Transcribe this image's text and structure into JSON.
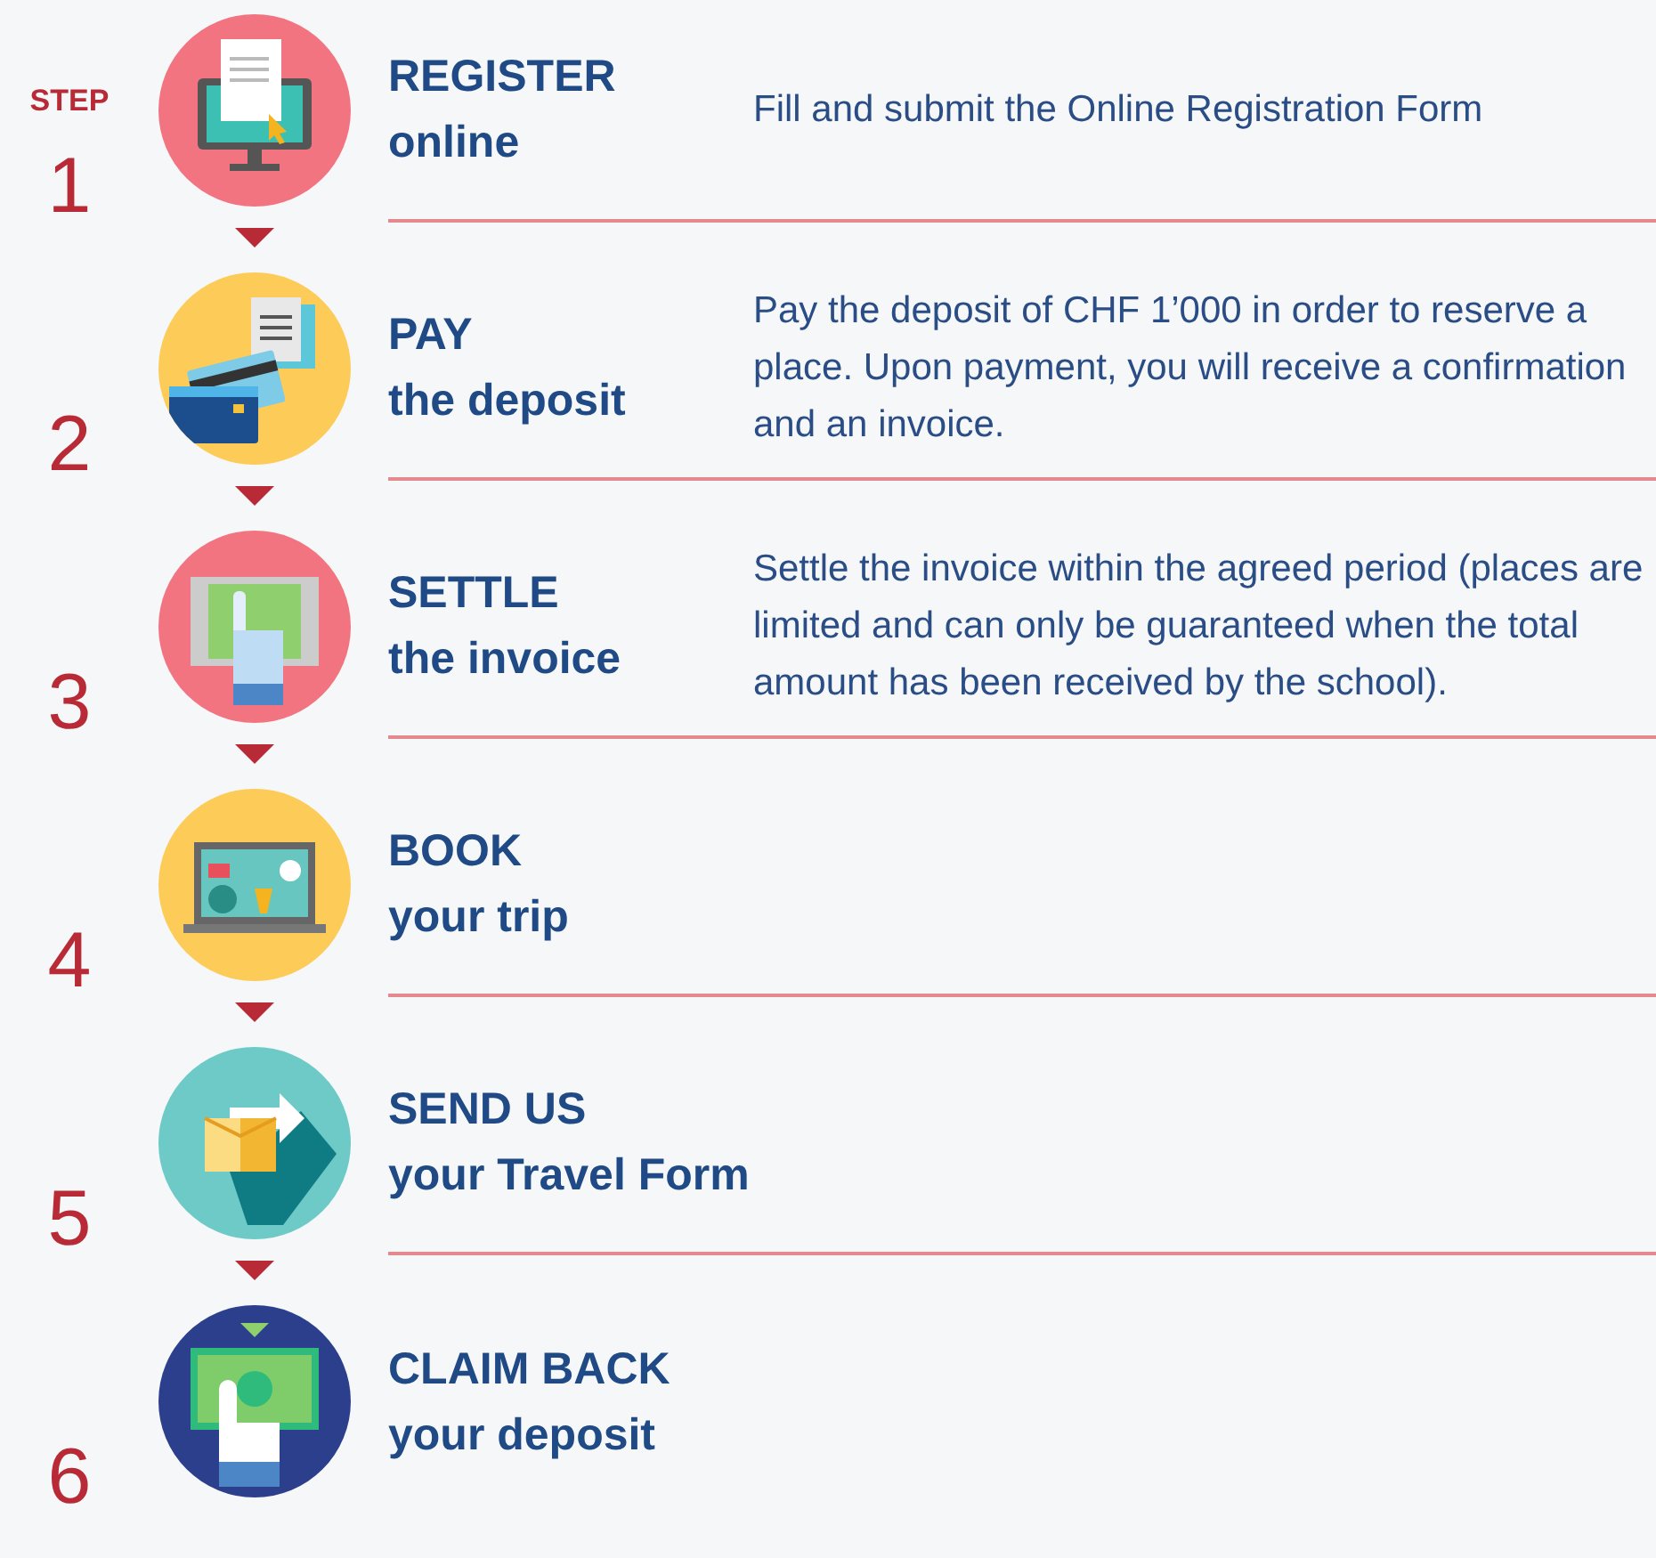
{
  "step_label": "STEP",
  "steps": [
    {
      "number": "1",
      "kind": "monitor",
      "color": "#f27480",
      "title": "REGISTER",
      "subtitle": "online",
      "description": "Fill and submit the Online Registration Form"
    },
    {
      "number": "2",
      "kind": "cards",
      "color": "#fdcb58",
      "title": "PAY",
      "subtitle": "the deposit",
      "description": "Pay the deposit of CHF 1’000 in order to reserve a place. Upon payment, you will receive a confirmation and an invoice."
    },
    {
      "number": "3",
      "kind": "tablet",
      "color": "#f27480",
      "title": "SETTLE",
      "subtitle": "the invoice",
      "description": "Settle the invoice within the agreed period (places are limited and can only be guaranteed when the total amount has been received by the school)."
    },
    {
      "number": "4",
      "kind": "laptop",
      "color": "#fdcb58",
      "title": "BOOK",
      "subtitle": "your trip"
    },
    {
      "number": "5",
      "kind": "envelope",
      "color": "#6ecac6",
      "title": "SEND US",
      "subtitle": "your Travel Form"
    },
    {
      "number": "6",
      "kind": "banknote",
      "color": "#2b3f8c",
      "title": "CLAIM BACK",
      "subtitle": "your deposit"
    }
  ]
}
